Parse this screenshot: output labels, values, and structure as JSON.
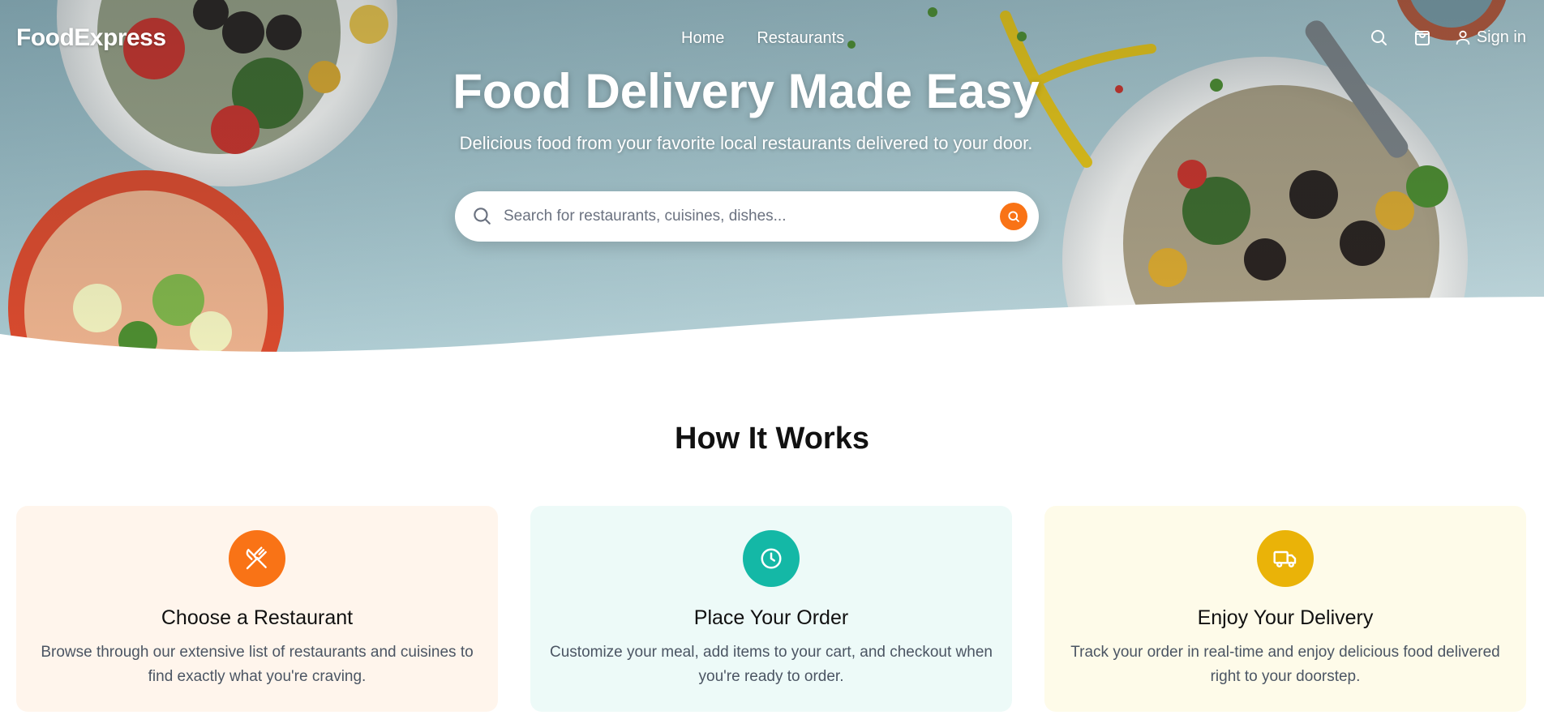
{
  "header": {
    "logo": "FoodExpress",
    "nav": [
      "Home",
      "Restaurants"
    ],
    "signin_label": "Sign in",
    "icons": [
      "search-icon",
      "shopping-bag-icon",
      "user-icon"
    ]
  },
  "hero": {
    "title": "Food Delivery Made Easy",
    "subtitle": "Delicious food from your favorite local restaurants delivered to your door.",
    "search_placeholder": "Search for restaurants, cuisines, dishes..."
  },
  "how_it_works": {
    "title": "How It Works",
    "steps": [
      {
        "title": "Choose a Restaurant",
        "description": "Browse through our extensive list of restaurants and cuisines to find exactly what you're craving.",
        "icon": "utensils-crossed-icon",
        "color": "#f97316"
      },
      {
        "title": "Place Your Order",
        "description": "Customize your meal, add items to your cart, and checkout when you're ready to order.",
        "icon": "clock-icon",
        "color": "#14b8a6"
      },
      {
        "title": "Enjoy Your Delivery",
        "description": "Track your order in real-time and enjoy delicious food delivered right to your doorstep.",
        "icon": "truck-icon",
        "color": "#eab308"
      }
    ]
  },
  "colors": {
    "accent": "#f97316",
    "teal": "#14b8a6",
    "yellow": "#eab308"
  }
}
